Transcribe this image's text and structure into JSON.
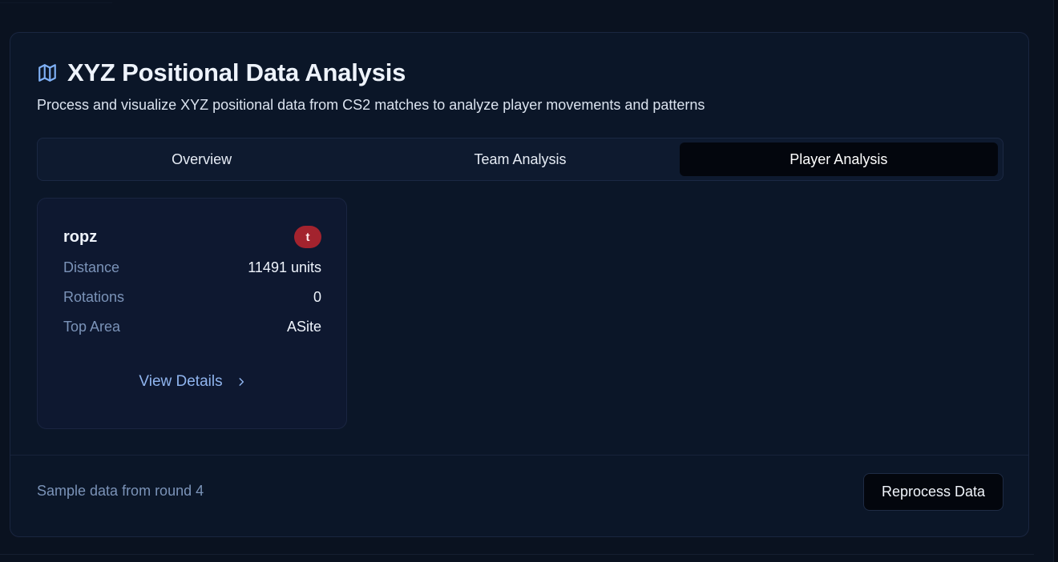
{
  "panel": {
    "title": "XYZ Positional Data Analysis",
    "subtitle": "Process and visualize XYZ positional data from CS2 matches to analyze player movements and patterns",
    "icon": "map-icon"
  },
  "tabs": [
    {
      "label": "Overview",
      "active": false
    },
    {
      "label": "Team Analysis",
      "active": false
    },
    {
      "label": "Player Analysis",
      "active": true
    }
  ],
  "player": {
    "name": "ropz",
    "team_badge": "t",
    "stats": [
      {
        "label": "Distance",
        "value": "11491 units"
      },
      {
        "label": "Rotations",
        "value": "0"
      },
      {
        "label": "Top Area",
        "value": "ASite"
      }
    ],
    "view_details_label": "View Details"
  },
  "footer": {
    "note": "Sample data from round 4",
    "reprocess_label": "Reprocess Data"
  },
  "colors": {
    "accent": "#7fb0f5",
    "team_t": "#a3232e",
    "active_tab": "#03060d"
  }
}
